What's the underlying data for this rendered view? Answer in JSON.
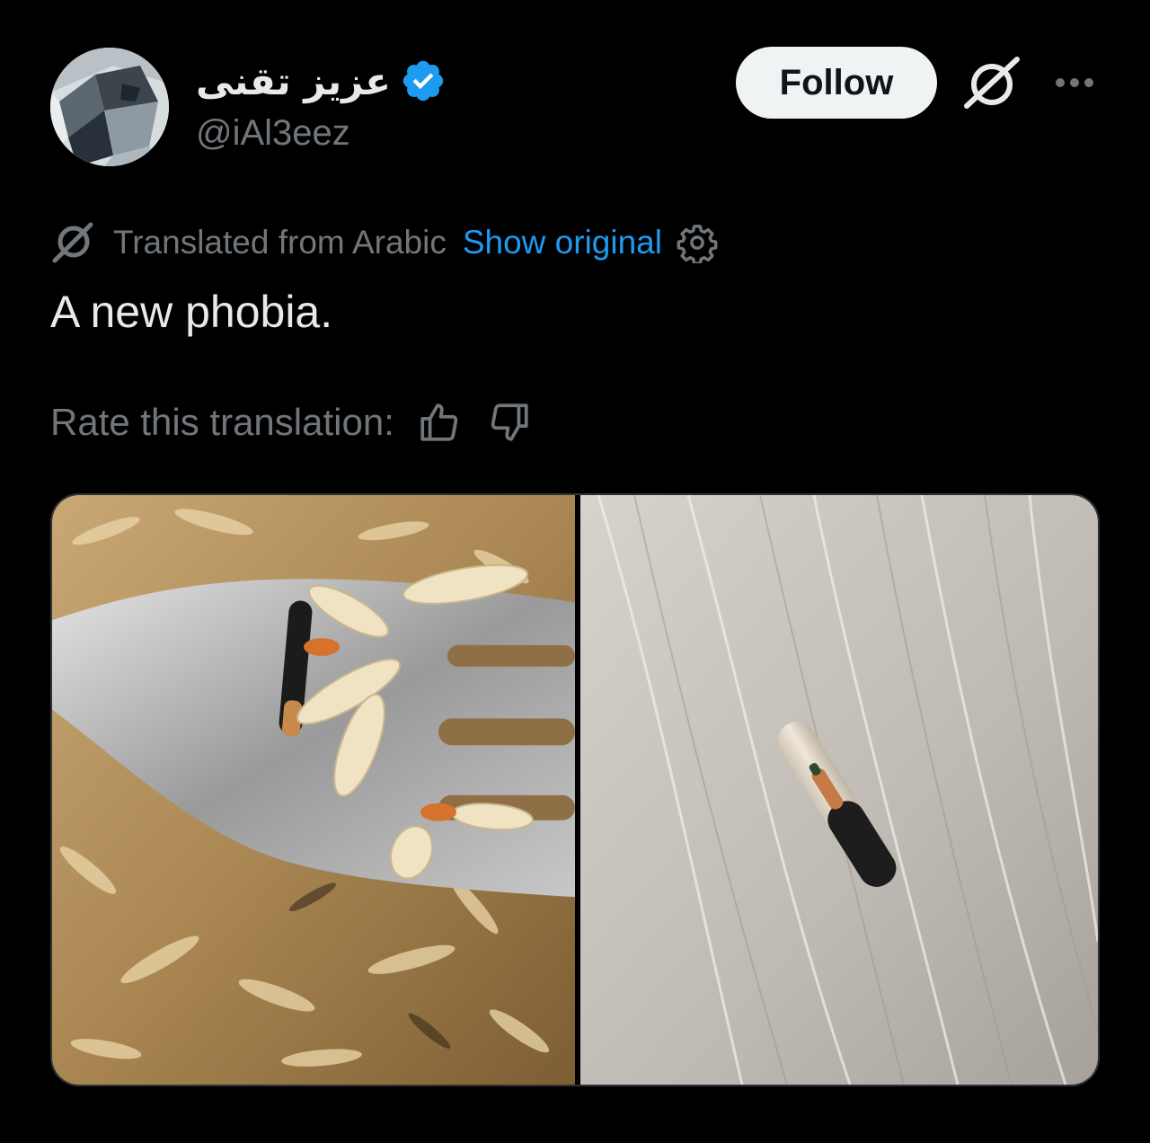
{
  "author": {
    "display_name": "عزيز تقنى",
    "handle": "@iAl3eez",
    "verified": true,
    "verified_color": "#1d9bf0"
  },
  "actions": {
    "follow_label": "Follow",
    "grok_icon": "grok-icon",
    "more_icon": "more-dots-icon"
  },
  "translation": {
    "label": "Translated from Arabic",
    "show_original": "Show original",
    "settings_icon": "gear-icon"
  },
  "post": {
    "text": "A new phobia."
  },
  "rating": {
    "label": "Rate this translation:",
    "up_icon": "thumbs-up-icon",
    "down_icon": "thumbs-down-icon"
  },
  "media": {
    "count": 2,
    "images": [
      {
        "name": "fork-with-rice-and-microchip-photo"
      },
      {
        "name": "microchip-on-table-photo"
      }
    ]
  },
  "colors": {
    "background": "#000000",
    "primary_text": "#e7e9ea",
    "secondary_text": "#71767b",
    "link": "#1d9bf0",
    "follow_bg": "#eff3f4"
  }
}
